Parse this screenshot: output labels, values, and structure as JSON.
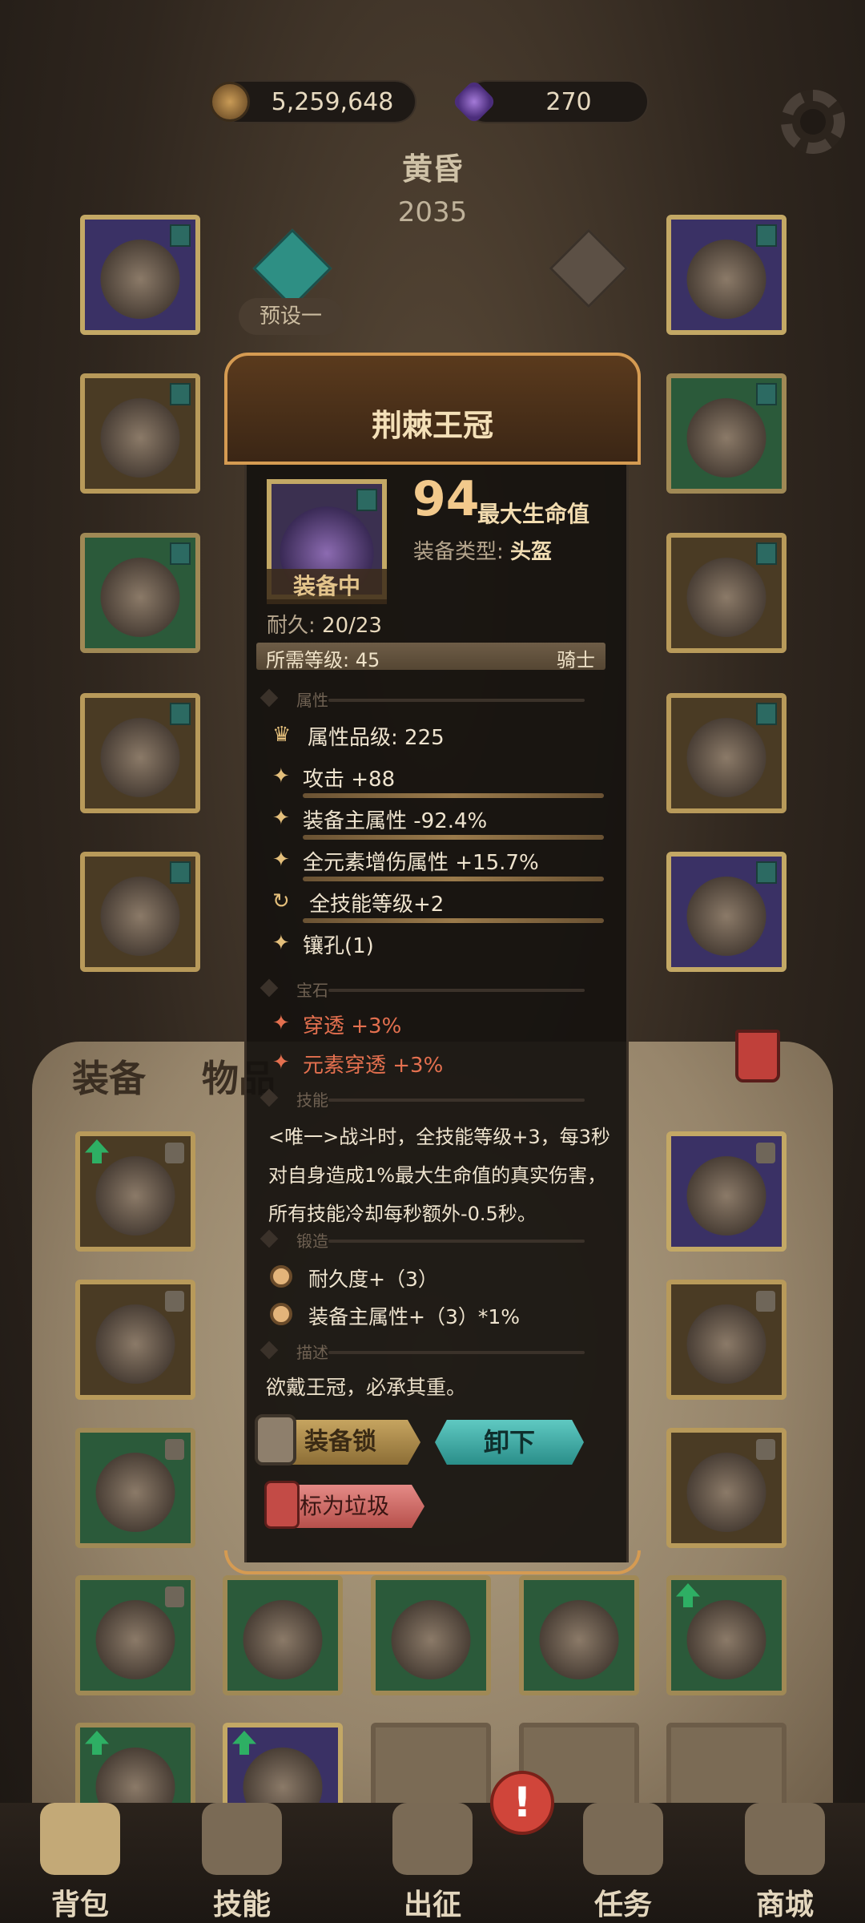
{
  "currency": {
    "gold": "5,259,648",
    "gems": "270"
  },
  "hero": {
    "name": "黄昏",
    "power": "2035",
    "preset": "预设一"
  },
  "tabs": {
    "equip": "装备",
    "items": "物品"
  },
  "item": {
    "name": "荆棘王冠",
    "equipped": "装备中",
    "stat_value": "94",
    "stat_label": "最大生命值",
    "type_label": "装备类型:",
    "type_value": "头盔",
    "durability_label": "耐久:",
    "durability_value": "20/23",
    "required_level": "所需等级: 45",
    "class": "骑士",
    "sections": {
      "attributes": "属性",
      "gems": "宝石",
      "skills": "技能",
      "forge": "锻造",
      "description": "描述"
    },
    "attribute_grade": "属性品级: 225",
    "attributes": [
      "攻击 +88",
      "装备主属性 -92.4%",
      "全元素增伤属性 +15.7%",
      "全技能等级+2",
      "镶孔(1)"
    ],
    "gems": [
      "穿透 +3%",
      "元素穿透 +3%"
    ],
    "skill_text": "<唯一>战斗时，全技能等级+3，每3秒对自身造成1%最大生命值的真实伤害，所有技能冷却每秒额外-0.5秒。",
    "forge": [
      "耐久度+（3）",
      "装备主属性+（3）*1%"
    ],
    "description": "欲戴王冠，必承其重。"
  },
  "buttons": {
    "lock": "装备锁",
    "unequip": "卸下",
    "junk": "标为垃圾"
  },
  "nav": [
    {
      "label": "背包"
    },
    {
      "label": "技能"
    },
    {
      "label": "出征"
    },
    {
      "label": "任务"
    },
    {
      "label": "商城"
    }
  ],
  "alert": "!"
}
